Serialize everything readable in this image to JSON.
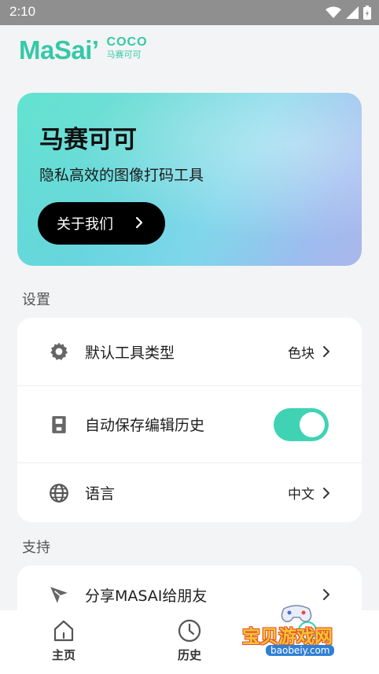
{
  "status_bar": {
    "time": "2:10"
  },
  "logo": {
    "main": "MaSai’",
    "coco": "COCO",
    "cn": "马赛可可"
  },
  "hero": {
    "title": "马赛可可",
    "subtitle": "隐私高效的图像打码工具",
    "button_label": "关于我们"
  },
  "settings": {
    "section_title": "设置",
    "items": [
      {
        "label": "默认工具类型",
        "value": "色块",
        "icon": "gear-icon"
      },
      {
        "label": "自动保存编辑历史",
        "toggle_on": true,
        "icon": "save-icon"
      },
      {
        "label": "语言",
        "value": "中文",
        "icon": "globe-icon"
      }
    ]
  },
  "support": {
    "section_title": "支持",
    "items": [
      {
        "label": "分享MASAI给朋友",
        "icon": "share-plane-icon"
      }
    ]
  },
  "bottom_nav": {
    "items": [
      {
        "label": "主页",
        "icon": "home-icon"
      },
      {
        "label": "历史",
        "icon": "clock-icon"
      },
      {
        "label": "",
        "icon": "settings-tab-icon"
      }
    ]
  },
  "watermark": {
    "text": "宝贝游戏网",
    "url": "baobeiy.com"
  },
  "colors": {
    "accent": "#3fd3b4",
    "status_bar": "#8f8f8f",
    "background": "#f3f4f6"
  }
}
